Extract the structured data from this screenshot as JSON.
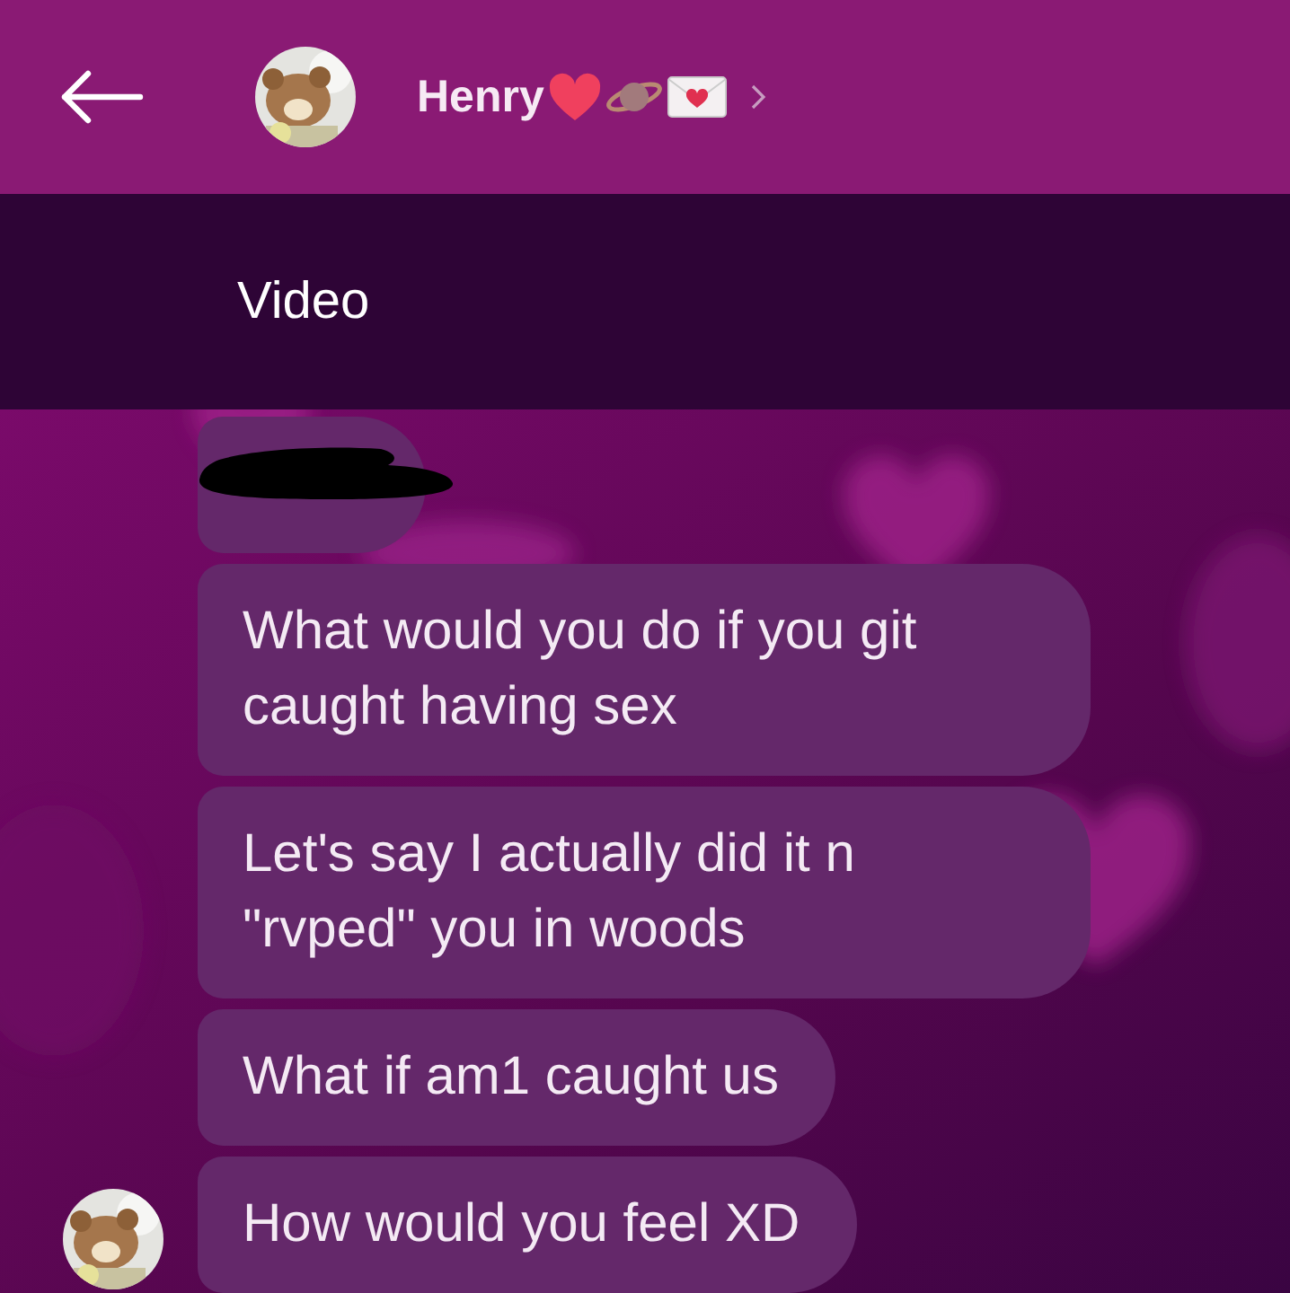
{
  "header": {
    "contact_name": "Henry"
  },
  "media_bar": {
    "label": "Video"
  },
  "messages": [
    {
      "kind": "redacted",
      "avatar": false
    },
    {
      "kind": "text",
      "text": "What would you do if you git caught having sex",
      "avatar": false
    },
    {
      "kind": "text",
      "text": "Let's say I actually did it n \"rvped\" you in woods",
      "avatar": false
    },
    {
      "kind": "text",
      "text": "What if am1 caught us",
      "avatar": false
    },
    {
      "kind": "text",
      "text": "How would you feel XD",
      "avatar": true
    }
  ]
}
